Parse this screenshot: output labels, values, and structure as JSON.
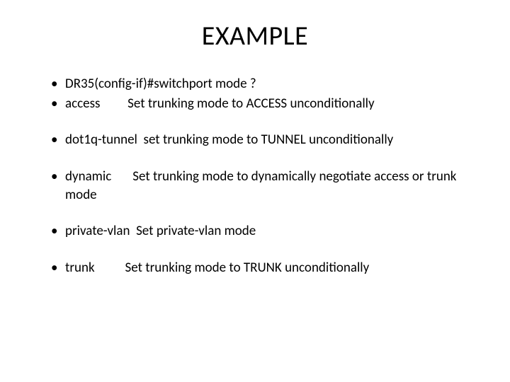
{
  "title": "EXAMPLE",
  "bullets": {
    "b1": "DR35(config-if)#switchport mode ?",
    "b2": " access         Set trunking mode to ACCESS unconditionally",
    "b3": " dot1q-tunnel  set trunking mode to TUNNEL unconditionally",
    "b4": " dynamic       Set trunking mode to dynamically negotiate access or trunk mode",
    "b5": " private-vlan  Set private-vlan mode",
    "b6": " trunk          Set trunking mode to TRUNK unconditionally"
  }
}
